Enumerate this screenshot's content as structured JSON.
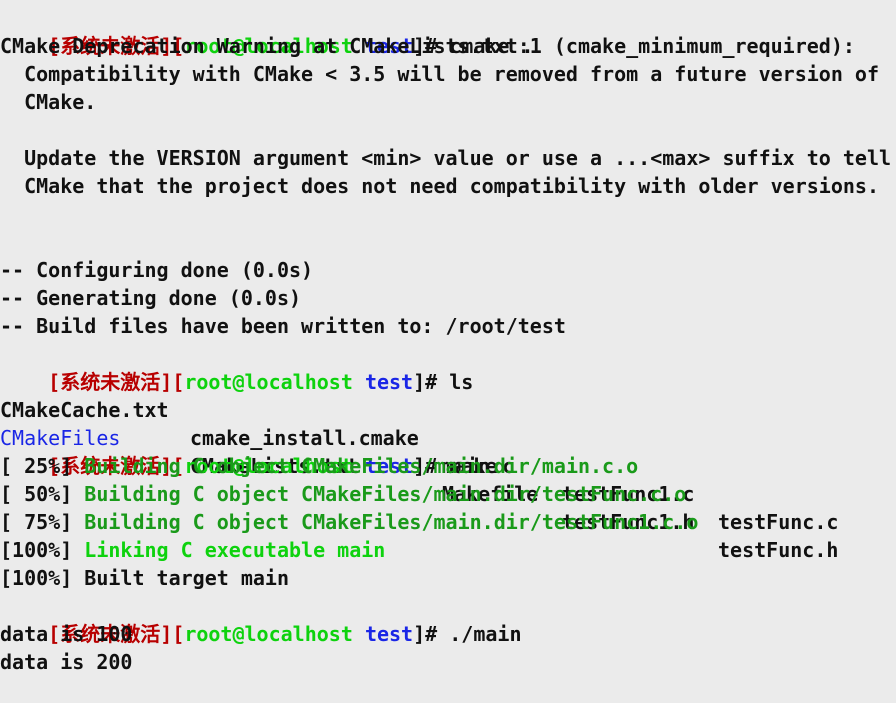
{
  "prompt": {
    "open": "[",
    "status": "系统未激活",
    "mid": "][",
    "user_host": "root@localhost",
    "cwd": "test",
    "close": "]#"
  },
  "blocks": {
    "cmd1": " cmake .",
    "warn1": "CMake Deprecation Warning at CMakeLists.txt:1 (cmake_minimum_required):",
    "warn2": "  Compatibility with CMake < 3.5 will be removed from a future version of",
    "warn3": "  CMake.",
    "warn4": "  Update the VERSION argument <min> value or use a ...<max> suffix to tell",
    "warn5": "  CMake that the project does not need compatibility with older versions.",
    "cfg1": "-- Configuring done (0.0s)",
    "cfg2": "-- Generating done (0.0s)",
    "cfg3": "-- Build files have been written to: /root/test",
    "cmd2": " ls",
    "ls": {
      "r1": [
        "CMakeCache.txt",
        "cmake_install.cmake",
        "main.c",
        "testFunc1.c",
        "testFunc.c"
      ],
      "r2": [
        "CMakeFiles",
        "CMakeLists.txt",
        "Makefile",
        "testFunc1.h",
        "testFunc.h"
      ]
    },
    "cmd3": " make",
    "b1_pct": "[ 25%] ",
    "b1_msg": "Building C object CMakeFiles/main.dir/main.c.o",
    "b2_pct": "[ 50%] ",
    "b2_msg": "Building C object CMakeFiles/main.dir/testFunc.c.o",
    "b3_pct": "[ 75%] ",
    "b3_msg": "Building C object CMakeFiles/main.dir/testFunc1.c.o",
    "b4_pct": "[100%] ",
    "b4_msg": "Linking C executable main",
    "b5": "[100%] Built target main",
    "cmd4": " ./main",
    "out1": "data is 100",
    "out2": "data is 200",
    "cmd5": " "
  },
  "colors": {
    "background": "#ebebeb",
    "text": "#111111",
    "prompt_status": "#b80000",
    "prompt_user": "#0ed20e",
    "prompt_cwd": "#1a26e6",
    "build_msg": "#1a9a1a",
    "dir_name": "#1a26e6"
  }
}
